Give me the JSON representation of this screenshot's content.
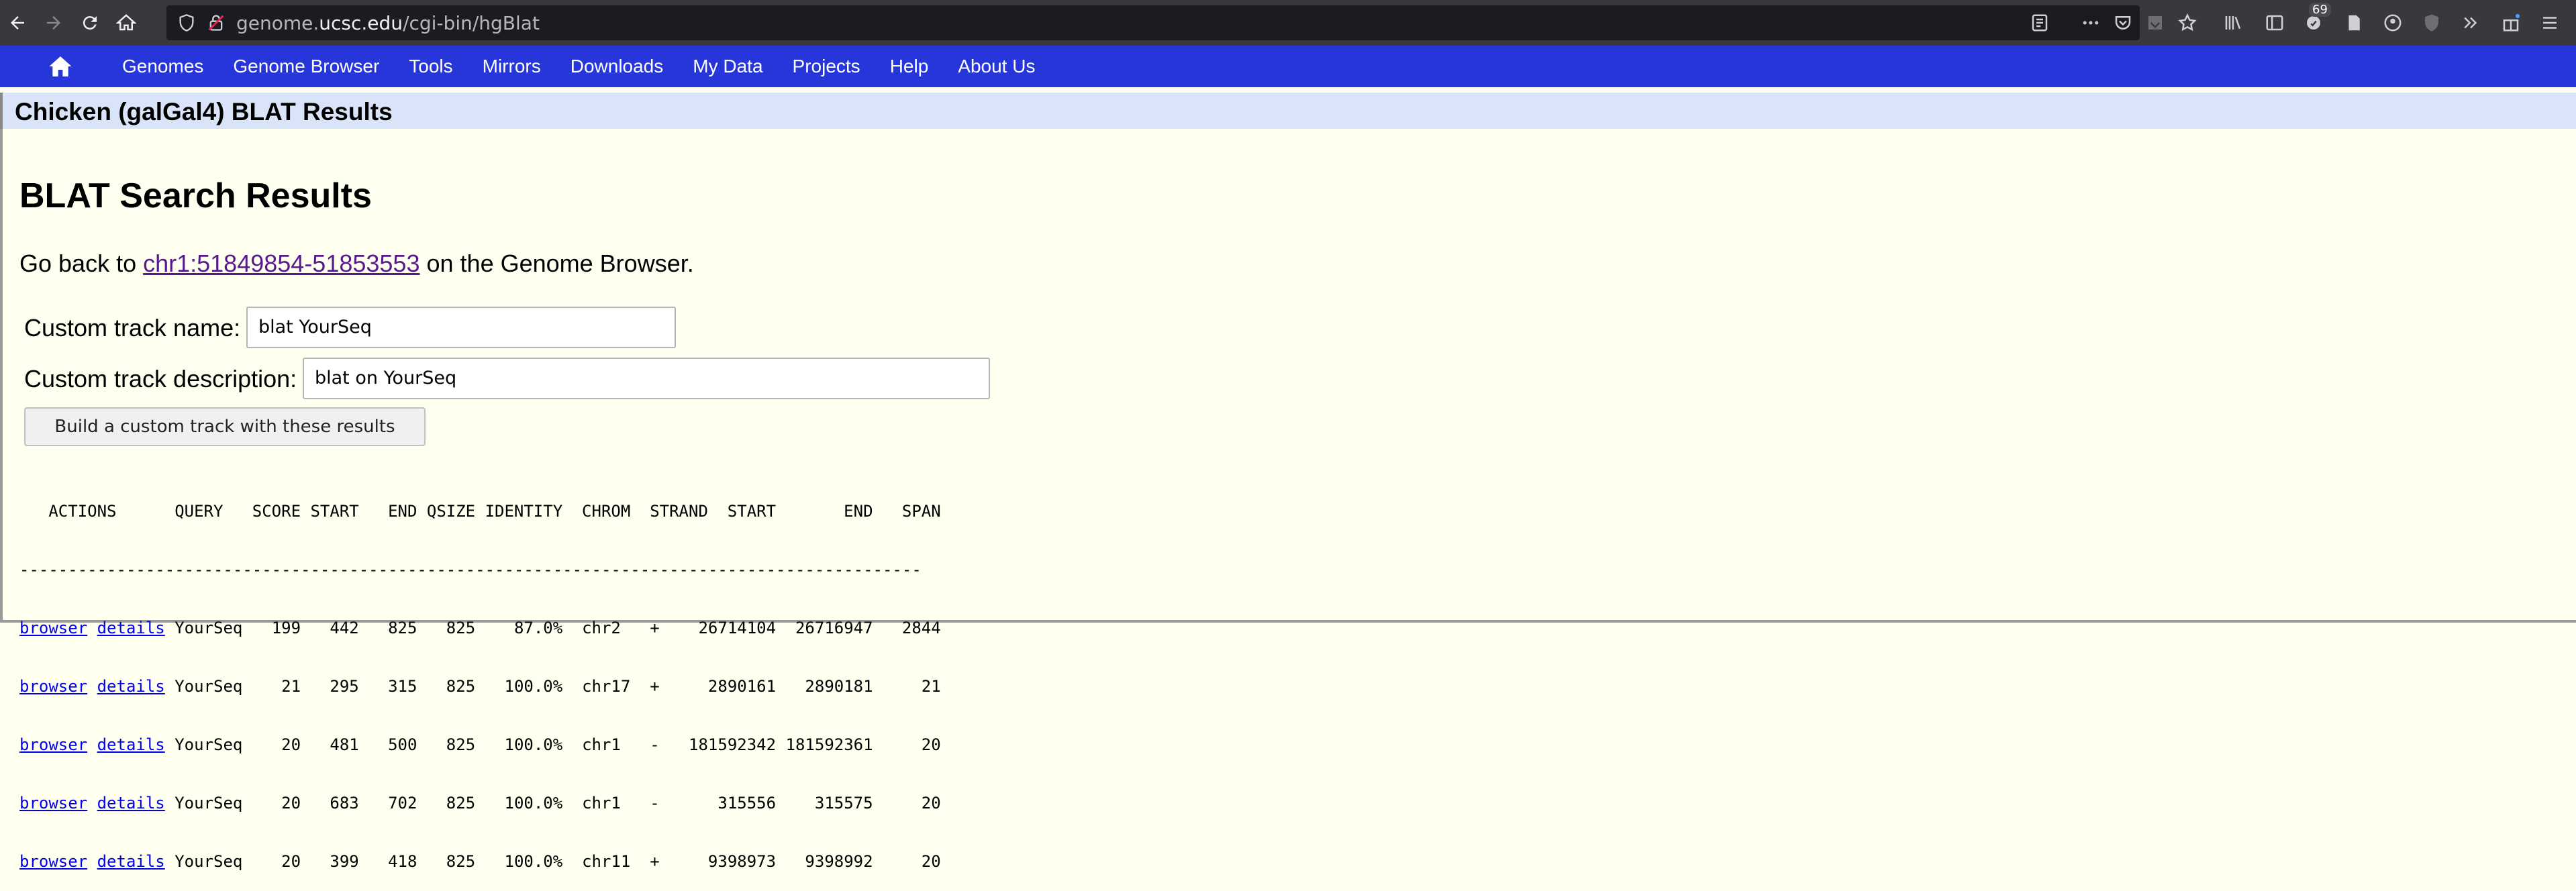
{
  "browser": {
    "url_prefix": "genome.",
    "url_host": "ucsc.edu",
    "url_path": "/cgi-bin/hgBlat",
    "notification_count": "69"
  },
  "nav": {
    "items": [
      "Genomes",
      "Genome Browser",
      "Tools",
      "Mirrors",
      "Downloads",
      "My Data",
      "Projects",
      "Help",
      "About Us"
    ]
  },
  "page": {
    "section_title": "Chicken (galGal4) BLAT Results",
    "main_title": "BLAT Search Results",
    "goback_prefix": "Go back to",
    "goback_link": "chr1:51849854-51853553",
    "goback_suffix": "on the Genome Browser.",
    "track_name_label": "Custom track name:",
    "track_name_value": "blat YourSeq",
    "track_desc_label": "Custom track description:",
    "track_desc_value": "blat on YourSeq",
    "build_button": "Build a custom track with these results"
  },
  "results": {
    "header": "   ACTIONS      QUERY   SCORE START   END QSIZE IDENTITY  CHROM  STRAND  START       END   SPAN",
    "separator": "---------------------------------------------------------------------------------------------",
    "link_browser": "browser",
    "link_details": "details",
    "rows": [
      " YourSeq   199   442   825   825    87.0%  chr2   +    26714104  26716947   2844",
      " YourSeq    21   295   315   825   100.0%  chr17  +     2890161   2890181     21",
      " YourSeq    20   481   500   825   100.0%  chr1   -   181592342 181592361     20",
      " YourSeq    20   683   702   825   100.0%  chr1   -      315556    315575     20",
      " YourSeq    20   399   418   825   100.0%  chr11  +     9398973   9398992     20"
    ]
  }
}
